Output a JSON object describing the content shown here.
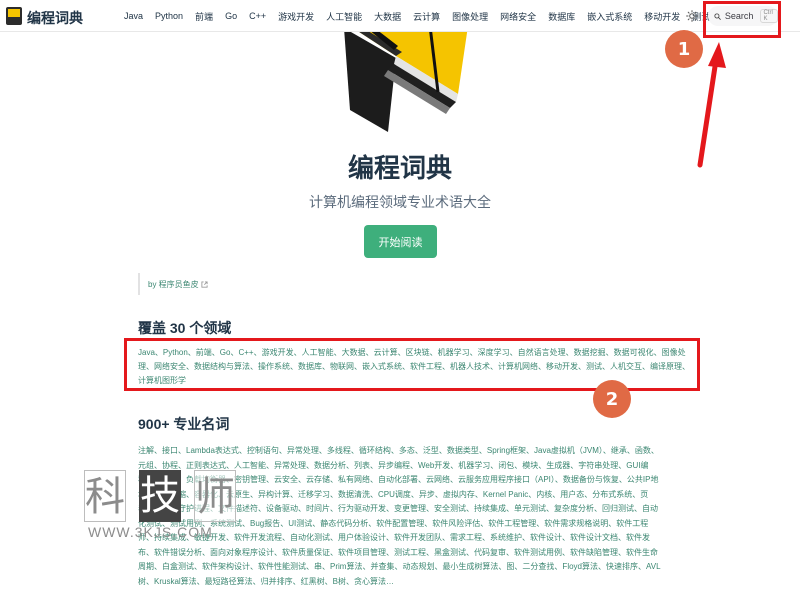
{
  "nav": {
    "site_name": "编程词典",
    "links": [
      "Java",
      "Python",
      "前端",
      "Go",
      "C++",
      "游戏开发",
      "人工智能",
      "大数据",
      "云计算",
      "图像处理",
      "网络安全",
      "数据库",
      "嵌入式系统",
      "移动开发",
      "测试"
    ],
    "search": {
      "label": "Search",
      "shortcut": "Ctrl K"
    }
  },
  "hero": {
    "title": "编程词典",
    "tagline": "计算机编程领域专业术语大全",
    "start_button": "开始阅读"
  },
  "author": {
    "label": "by 程序员鱼皮"
  },
  "domains": {
    "heading": "覆盖 30 个领域",
    "text": "Java、Python、前端、Go、C++、游戏开发、人工智能、大数据、云计算、区块链、机器学习、深度学习、自然语言处理、数据挖掘、数据可视化、图像处理、网络安全、数据结构与算法、操作系统、数据库、物联网、嵌入式系统、软件工程、机器人技术、计算机网络、移动开发、测试、人机交互、编译原理、计算机图形学"
  },
  "terms": {
    "heading": "900+ 专业名词",
    "text": "注解、接口、Lambda表达式、控制语句、异常处理、多线程、循环结构、多态、泛型、数据类型、Spring框架、Java虚拟机（JVM）、继承、函数、元组、协程、正则表达式、人工智能、异常处理、数据分析、列表、异步编程、Web开发、机器学习、闭包、模块、生成器、字符串处理、GUI编程、混合云、负载均衡器、密钥管理、云安全、云存储、私有网络、自动化部署、云网络、云服务应用程序接口（API）、数据备份与恢复、公共IP地址、弹性伸缩、容器化、云原生、异构计算、迁移学习、数据清洗、CPU调度、异步、虚拟内存、Kernel Panic、内核、用户态、分布式系统、页表、线程、守护进程、文件描述符、设备驱动、时间片、行为驱动开发、变更管理、安全测试、持续集成、单元测试、复杂度分析、回归测试、自动化测试、测试用例、系统测试、Bug报告、UI测试、静态代码分析、软件配置管理、软件风险评估、软件工程管理、软件需求规格说明、软件工程师、持续集成、敏捷开发、软件开发流程、自动化测试、用户体验设计、软件开发团队、需求工程、系统维护、软件设计、软件设计文档、软件发布、软件错误分析、面向对象程序设计、软件质量保证、软件项目管理、测试工程、黑盒测试、代码复审、软件测试用例、软件缺陷管理、软件生命周期、白盒测试、软件架构设计、软件性能测试、串、Prim算法、并查集、动态规划、最小生成树算法、图、二分查找、Floyd算法、快速排序、AVL树、Kruskal算法、最短路径算法、归并排序、红黑树、B树、贪心算法…"
  },
  "badges": {
    "one": "1",
    "two": "2"
  },
  "watermark": {
    "chars": [
      "科",
      "技",
      "师"
    ],
    "url": "WWW.3KJS.COM"
  },
  "colors": {
    "accent": "#3eaf7c",
    "annotation_red": "#e4181c",
    "badge": "#e06a45"
  },
  "icons": {
    "theme": "sun-icon",
    "search": "search-icon",
    "external": "external-link-icon"
  }
}
